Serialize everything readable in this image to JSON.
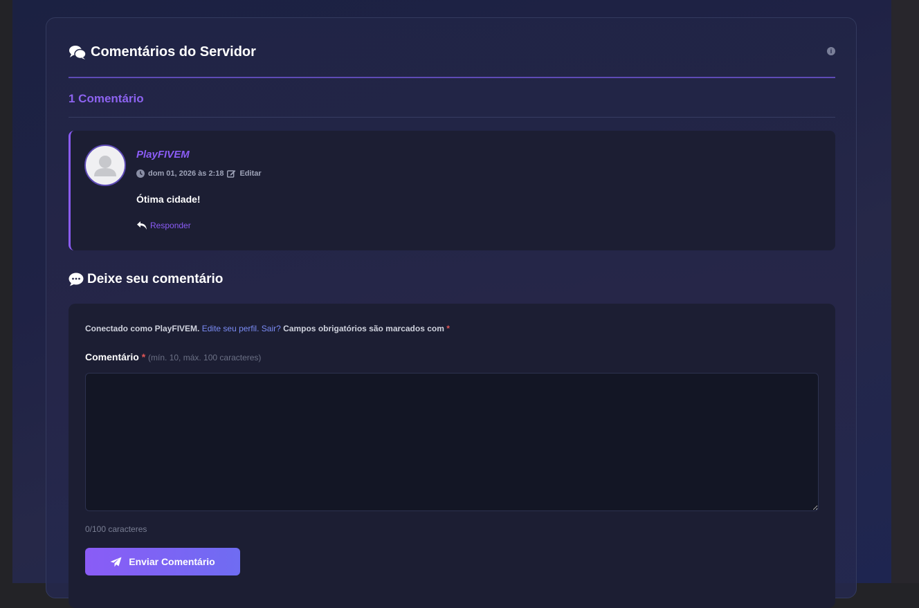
{
  "header": {
    "title": "Comentários do Servidor",
    "title_icon": "comments-icon",
    "info_icon": "info-icon"
  },
  "comments": {
    "count_label": "1 Comentário",
    "items": [
      {
        "author": "PlayFIVEM",
        "date": "dom 01, 2026 às 2:18",
        "edit_label": "Editar",
        "text": "Ótima cidade!",
        "reply_label": "Responder"
      }
    ]
  },
  "form": {
    "title": "Deixe seu comentário",
    "title_icon": "comment-icon",
    "logged_prefix": "Conectado como PlayFIVEM.",
    "edit_profile_label": "Edite seu perfil.",
    "logout_label": "Sair?",
    "required_note": "Campos obrigatórios são marcados com",
    "required_mark": "*",
    "field_label": "Comentário",
    "field_hint": "(mín. 10, máx. 100 caracteres)",
    "field_value": "",
    "char_count": "0/100 caracteres",
    "submit_label": "Enviar Comentário",
    "submit_icon": "paper-plane-icon"
  },
  "colors": {
    "accent": "#8b5cf6",
    "link": "#7b8cf5",
    "required": "#e05656",
    "background": "#1f2245"
  }
}
